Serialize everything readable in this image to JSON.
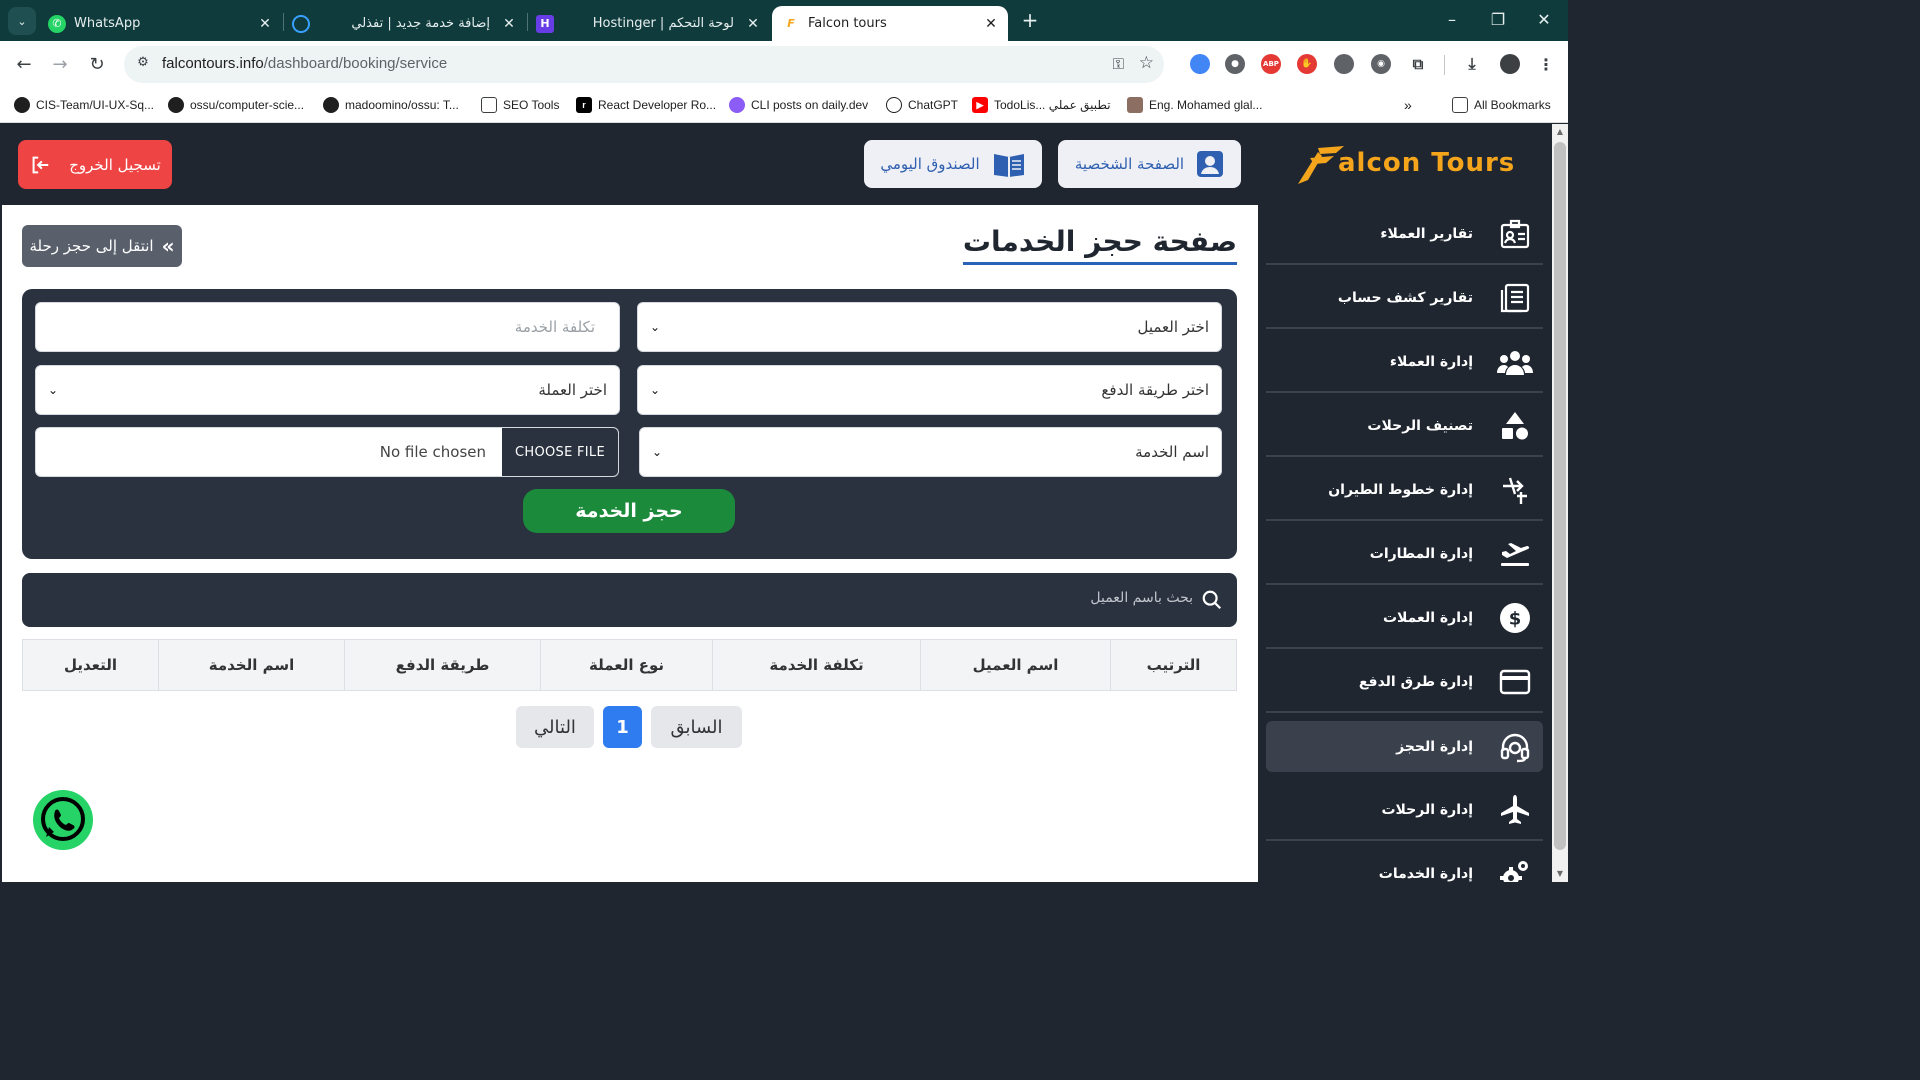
{
  "browser": {
    "tabs": [
      {
        "title": "WhatsApp",
        "active": false
      },
      {
        "title": "إضافة خدمة جديد | تفذلي",
        "active": false
      },
      {
        "title": "Hostinger | لوحة التحكم",
        "active": false
      },
      {
        "title": "Falcon tours",
        "active": true
      }
    ],
    "close_glyph": "✕",
    "new_tab_glyph": "+",
    "url_domain": "falcontours.info",
    "url_path": "/dashboard/booking/service",
    "bookmarks": [
      "CIS-Team/UI-UX-Sq...",
      "ossu/computer-scie...",
      "madoomino/ossu: T...",
      "SEO Tools",
      "React Developer Ro...",
      "CLI posts on daily.dev",
      "ChatGPT",
      "TodoLis... تطبيق عملي",
      "Eng. Mohamed glal..."
    ],
    "all_bookmarks": "All Bookmarks",
    "abp": "ABP"
  },
  "header": {
    "logout_label": "تسجيل الخروج",
    "daily_box_label": "الصندوق اليومي",
    "profile_label": "الصفحة الشخصية",
    "logo_text": "alcon Tours",
    "logo_letter": "F"
  },
  "page": {
    "title": "صفحة حجز الخدمات",
    "goto_label": "انتقل إلى حجز رحلة",
    "goto_glyph": "«"
  },
  "form": {
    "client_select": "اختر العميل",
    "service_cost_placeholder": "تكلفة الخدمة",
    "payment_method_select": "اختر طريقة الدفع",
    "currency_select": "اختر العملة",
    "service_name_select": "اسم الخدمة",
    "file_button": "CHOOSE FILE",
    "file_status": "No file chosen",
    "submit_label": "حجز الخدمة"
  },
  "search": {
    "placeholder": "بحث باسم العميل"
  },
  "table": {
    "columns": [
      "الترتيب",
      "اسم العميل",
      "تكلفة الخدمة",
      "نوع العملة",
      "طريقة الدفع",
      "اسم الخدمة",
      "التعديل"
    ]
  },
  "pagination": {
    "prev": "السابق",
    "current": "1",
    "next": "التالي"
  },
  "sidebar": {
    "items": [
      {
        "label": "تقارير العملاء",
        "icon": "id-card-icon",
        "active": false
      },
      {
        "label": "تقارير كشف حساب",
        "icon": "document-list-icon",
        "active": false
      },
      {
        "label": "إدارة العملاء",
        "icon": "users-icon",
        "active": false
      },
      {
        "label": "تصنيف الرحلات",
        "icon": "shapes-icon",
        "active": false
      },
      {
        "label": "إدارة خطوط الطيران",
        "icon": "plane-route-icon",
        "active": false
      },
      {
        "label": "إدارة المطارات",
        "icon": "plane-departure-icon",
        "active": false
      },
      {
        "label": "إدارة العملات",
        "icon": "dollar-icon",
        "active": false
      },
      {
        "label": "إدارة طرق الدفع",
        "icon": "credit-card-icon",
        "active": false
      },
      {
        "label": "إدارة الحجز",
        "icon": "headset-icon",
        "active": true
      },
      {
        "label": "إدارة الرحلات",
        "icon": "plane-icon",
        "active": false
      },
      {
        "label": "إدارة الخدمات",
        "icon": "gears-icon",
        "active": false
      }
    ]
  },
  "colors": {
    "dark": "#1f2630",
    "panel": "#2a323f",
    "accent": "#f4a51c",
    "danger": "#ef4444",
    "success": "#1b8a3b",
    "primary": "#2f7cf0"
  }
}
